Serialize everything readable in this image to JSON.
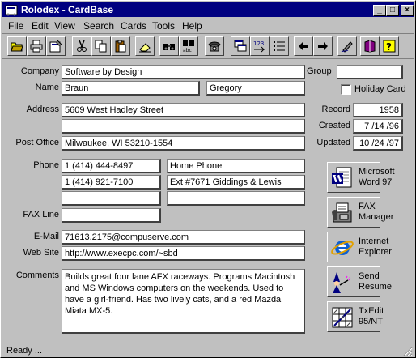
{
  "window": {
    "title": "Rolodex - CardBase"
  },
  "menu": [
    "File",
    "Edit",
    "View",
    "Search",
    "Cards",
    "Tools",
    "Help"
  ],
  "labels": {
    "company": "Company",
    "name": "Name",
    "address": "Address",
    "post_office": "Post Office",
    "phone": "Phone",
    "fax_line": "FAX Line",
    "email": "E-Mail",
    "web_site": "Web Site",
    "comments": "Comments",
    "group": "Group",
    "holiday_card": "Holiday Card",
    "record": "Record",
    "created": "Created",
    "updated": "Updated"
  },
  "fields": {
    "company": "Software by Design",
    "last_name": "Braun",
    "first_name": "Gregory",
    "address1": "5609 West Hadley Street",
    "address2": "",
    "post_office": "Milwaukee, WI  53210-1554",
    "phone1_number": "1 (414) 444-8497",
    "phone1_desc": "Home Phone",
    "phone2_number": "1 (414) 921-7100",
    "phone2_desc": "Ext #7671 Giddings & Lewis",
    "phone3_number": "",
    "phone3_desc": "",
    "fax": "",
    "email": "71613.2175@compuserve.com",
    "web_site": "http://www.execpc.com/~sbd",
    "comments": "Builds great four lane AFX raceways. Programs Macintosh and MS Windows computers on the weekends. Used to have a girl-friend. Has two lively cats, and a red Mazda Miata MX-5.",
    "group": "",
    "holiday_card": false,
    "record": "1958",
    "created": "7 /14 /96",
    "updated": "10 /24 /97"
  },
  "apps": [
    {
      "label1": "Microsoft",
      "label2": "Word 97",
      "icon": "word-icon"
    },
    {
      "label1": "FAX",
      "label2": "Manager",
      "icon": "fax-icon"
    },
    {
      "label1": "Internet",
      "label2": "Explorer",
      "icon": "ie-icon"
    },
    {
      "label1": "Send",
      "label2": "Resume",
      "icon": "wizard-icon"
    },
    {
      "label1": "TxEdit",
      "label2": "95/NT",
      "icon": "txedit-icon"
    }
  ],
  "status": {
    "text": "Ready ..."
  }
}
